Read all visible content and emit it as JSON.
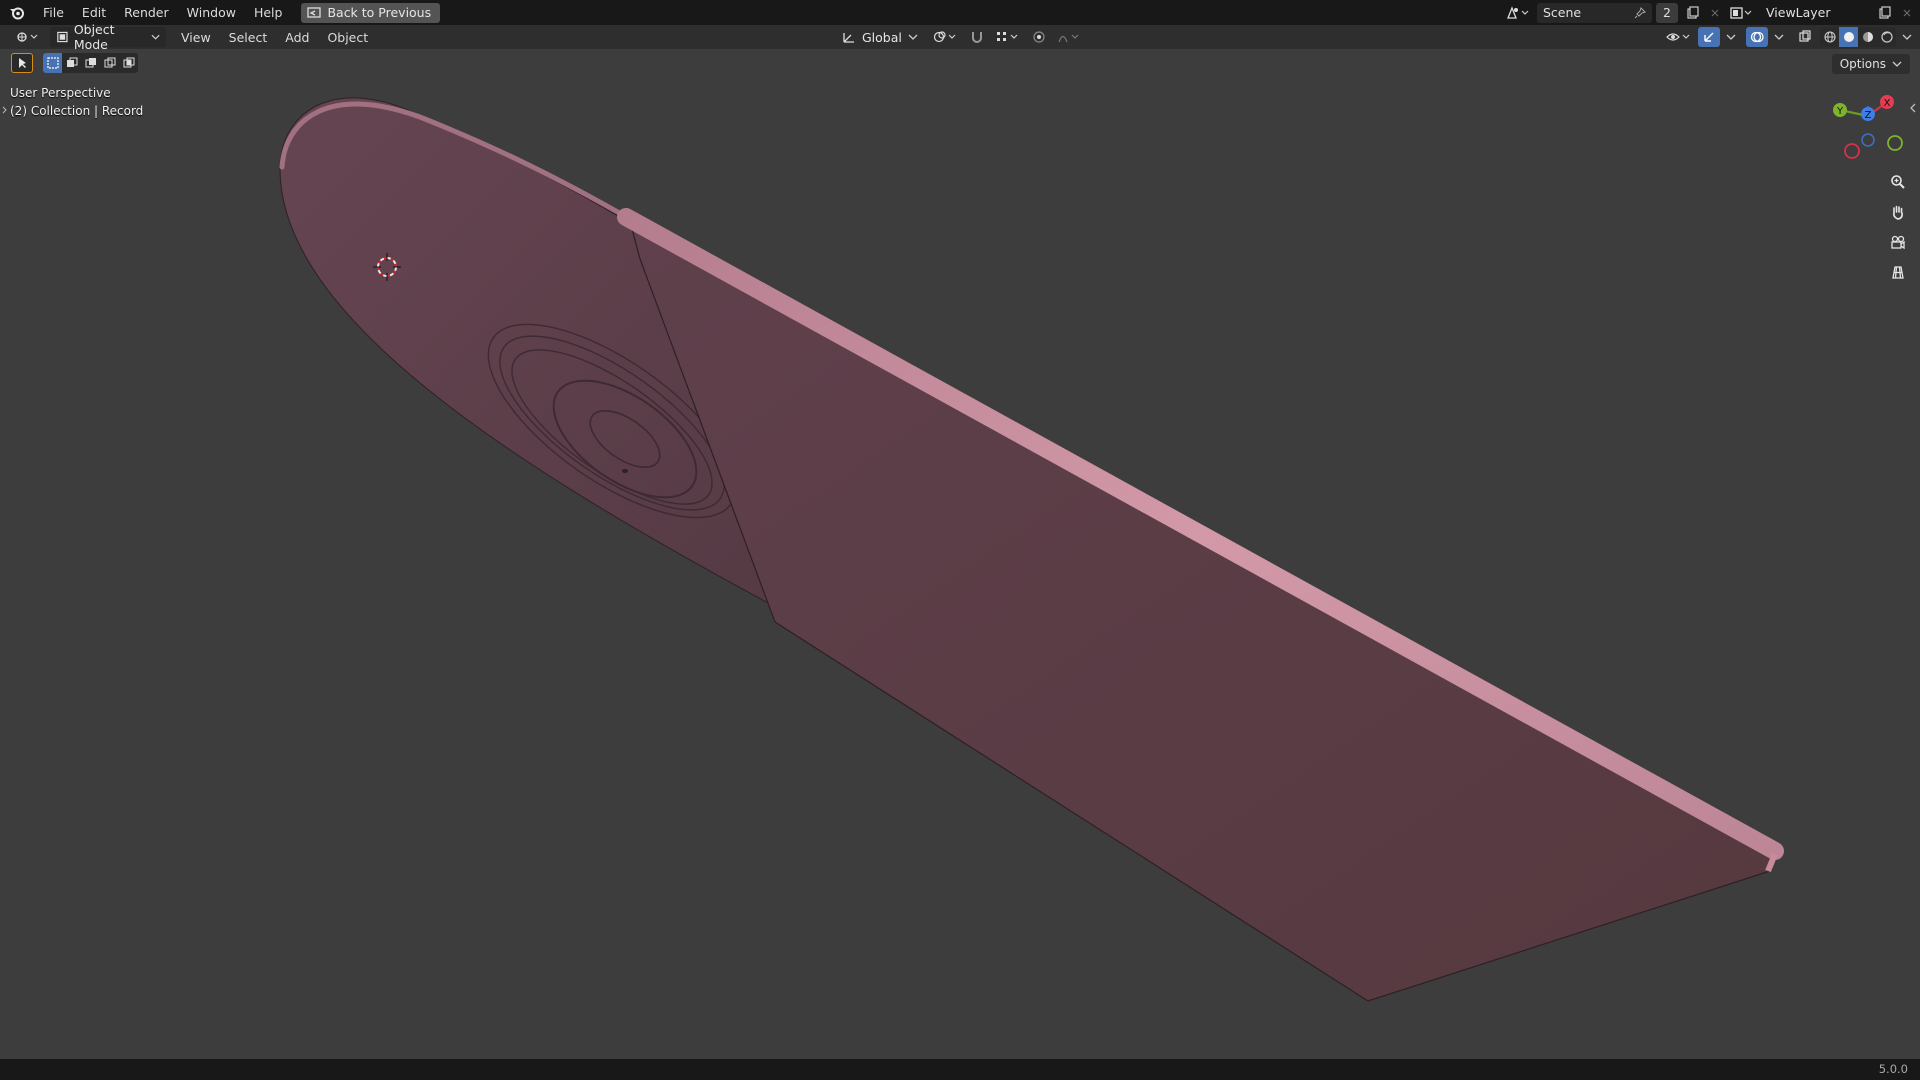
{
  "topbar": {
    "menus": [
      "File",
      "Edit",
      "Render",
      "Window",
      "Help"
    ],
    "back_button": "Back to Previous",
    "scene_name": "Scene",
    "scene_count": "2",
    "view_layer": "ViewLayer"
  },
  "header": {
    "mode": "Object Mode",
    "menus": [
      "View",
      "Select",
      "Add",
      "Object"
    ],
    "transform_orientation": "Global",
    "options_label": "Options"
  },
  "viewport": {
    "perspective_label": "User Perspective",
    "collection_label": "(2) Collection | Record",
    "gizmo": {
      "x": "X",
      "y": "Y",
      "z": "Z"
    },
    "object_color": "#5a3e48",
    "edge_highlight": "#c98a9c"
  },
  "status": {
    "version": "5.0.0"
  },
  "icons": [
    "blender-logo-icon",
    "editor-type-icon",
    "cube-icon",
    "transform-orientation-icon",
    "pivot-icon",
    "snap-icon",
    "proportional-edit-icon",
    "visibility-icon",
    "gizmo-icon",
    "overlay-icon",
    "xray-icon",
    "wireframe-shading-icon",
    "solid-shading-icon",
    "material-shading-icon",
    "rendered-shading-icon",
    "zoom-icon",
    "hand-pan-icon",
    "camera-icon",
    "grid-ortho-icon",
    "3d-cursor-icon"
  ]
}
